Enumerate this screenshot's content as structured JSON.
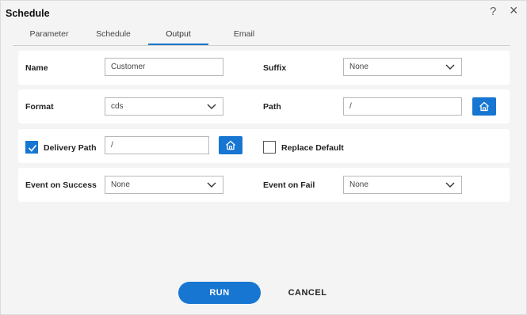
{
  "dialog": {
    "title": "Schedule",
    "help_glyph": "?",
    "close_glyph": "×"
  },
  "tabs": [
    {
      "label": "Parameter",
      "active": false
    },
    {
      "label": "Schedule",
      "active": false
    },
    {
      "label": "Output",
      "active": true
    },
    {
      "label": "Email",
      "active": false
    }
  ],
  "form": {
    "name_label": "Name",
    "name_value": "Customer",
    "suffix_label": "Suffix",
    "suffix_value": "None",
    "format_label": "Format",
    "format_value": "cds",
    "path_label": "Path",
    "path_value": "/",
    "delivery_path_label": "Delivery Path",
    "delivery_path_checked": true,
    "delivery_path_value": "/",
    "replace_default_label": "Replace Default",
    "replace_default_checked": false,
    "event_success_label": "Event on Success",
    "event_success_value": "None",
    "event_fail_label": "Event on Fail",
    "event_fail_value": "None"
  },
  "actions": {
    "run_label": "RUN",
    "cancel_label": "CANCEL"
  },
  "icons": {
    "help": "help-icon",
    "close": "close-icon",
    "home": "home-icon",
    "chevron": "chevron-down-icon",
    "check": "checkmark-icon"
  },
  "colors": {
    "accent": "#1776d2",
    "background": "#f4f4f5"
  }
}
